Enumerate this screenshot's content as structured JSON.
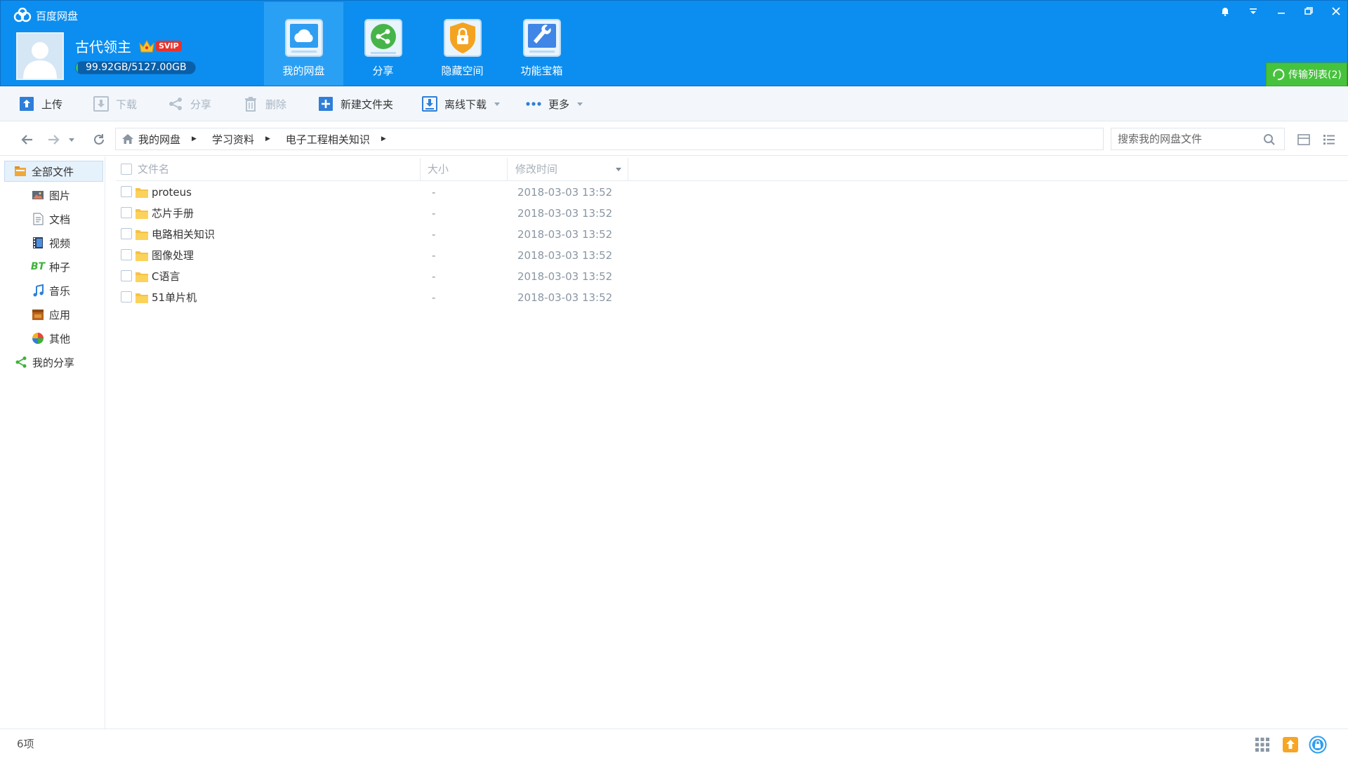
{
  "app": {
    "title": "百度网盘"
  },
  "user": {
    "name": "古代领主",
    "badge": "SVIP",
    "quota": "99.92GB/5127.00GB",
    "quota_used_fraction": 0.0195
  },
  "nav_tabs": [
    {
      "label": "我的网盘",
      "icon": "cloud-drive-icon",
      "active": true
    },
    {
      "label": "分享",
      "icon": "share-icon",
      "active": false
    },
    {
      "label": "隐藏空间",
      "icon": "lock-shield-icon",
      "active": false
    },
    {
      "label": "功能宝箱",
      "icon": "toolbox-icon",
      "active": false
    }
  ],
  "window_controls": [
    "bell-icon",
    "menu-dropdown-icon",
    "minimize-icon",
    "restore-icon",
    "close-icon"
  ],
  "transfer_list": {
    "label": "传输列表(2)"
  },
  "toolbar": {
    "upload": "上传",
    "download": "下载",
    "share": "分享",
    "delete": "删除",
    "new_folder": "新建文件夹",
    "offline_download": "离线下载",
    "more": "更多"
  },
  "breadcrumb": [
    {
      "label": "我的网盘"
    },
    {
      "label": "学习资料"
    },
    {
      "label": "电子工程相关知识"
    }
  ],
  "search": {
    "placeholder": "搜索我的网盘文件"
  },
  "sidebar": {
    "items": [
      {
        "label": "全部文件",
        "icon": "all-files-icon"
      },
      {
        "label": "图片",
        "icon": "image-icon"
      },
      {
        "label": "文档",
        "icon": "document-icon"
      },
      {
        "label": "视频",
        "icon": "video-icon"
      },
      {
        "label": "种子",
        "icon": "bt-icon"
      },
      {
        "label": "音乐",
        "icon": "music-icon"
      },
      {
        "label": "应用",
        "icon": "app-icon"
      },
      {
        "label": "其他",
        "icon": "other-icon"
      },
      {
        "label": "我的分享",
        "icon": "share-icon"
      }
    ]
  },
  "list": {
    "columns": {
      "name": "文件名",
      "size": "大小",
      "modified": "修改时间"
    },
    "rows": [
      {
        "name": "proteus",
        "size": "-",
        "modified": "2018-03-03 13:52"
      },
      {
        "name": "芯片手册",
        "size": "-",
        "modified": "2018-03-03 13:52"
      },
      {
        "name": "电路相关知识",
        "size": "-",
        "modified": "2018-03-03 13:52"
      },
      {
        "name": "图像处理",
        "size": "-",
        "modified": "2018-03-03 13:52"
      },
      {
        "name": "C语言",
        "size": "-",
        "modified": "2018-03-03 13:52"
      },
      {
        "name": "51单片机",
        "size": "-",
        "modified": "2018-03-03 13:52"
      }
    ]
  },
  "status": {
    "count": "6项"
  },
  "colors": {
    "header_blue": "#0c8ef0",
    "accent_green": "#47c23d",
    "svip_red": "#e8332d"
  }
}
